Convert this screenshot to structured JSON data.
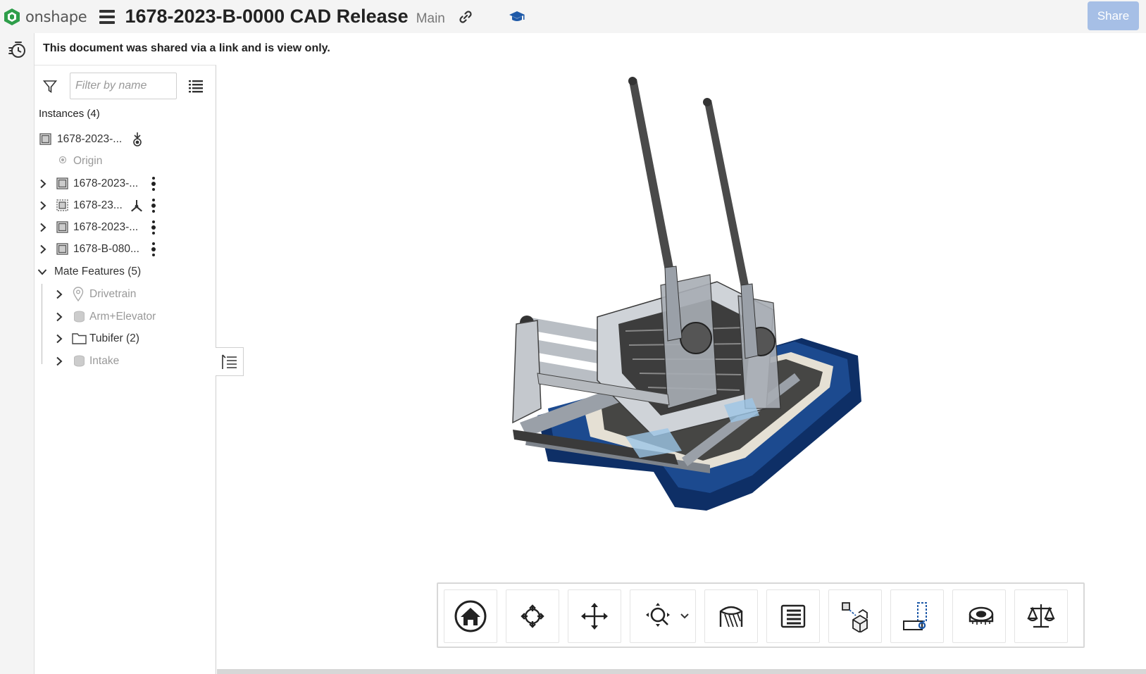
{
  "app": {
    "name": "onshape",
    "brand_color": "#2e9e4a",
    "accent_color": "#1f5aa8"
  },
  "header": {
    "title": "1678-2023-B-0000 CAD Release",
    "branch": "Main",
    "share_label": "Share",
    "share_color": "#a6bfe6"
  },
  "notice": "This document was shared via a link and is view only.",
  "panel": {
    "filter_placeholder": "Filter by name",
    "instances_header": "Instances (4)",
    "items": [
      {
        "label": "1678-2023-...",
        "icon": "part-studio-icon",
        "trailing": "fixed-icon"
      },
      {
        "label": "Origin",
        "icon": "origin-icon",
        "muted": true
      },
      {
        "label": "1678-2023-...",
        "icon": "part-studio-icon",
        "trailing": "kebab"
      },
      {
        "label": "1678-23...",
        "icon": "assembly-icon",
        "trailing": "mate-connector-icon"
      },
      {
        "label": "1678-2023-...",
        "icon": "part-studio-icon",
        "trailing": "kebab"
      },
      {
        "label": "1678-B-080...",
        "icon": "part-studio-icon",
        "trailing": "kebab"
      }
    ],
    "mate_header": "Mate Features (5)",
    "mates": [
      {
        "label": "Drivetrain",
        "icon": "pin-icon",
        "muted": true
      },
      {
        "label": "Arm+Elevator",
        "icon": "group-icon",
        "muted": true
      },
      {
        "label": "Tubifer (2)",
        "icon": "folder-icon",
        "muted": false
      },
      {
        "label": "Intake",
        "icon": "group-icon",
        "muted": true
      }
    ]
  },
  "toolbar": {
    "tools": [
      "home-view-icon",
      "rotate-icon",
      "pan-icon",
      "zoom-icon",
      "section-view-icon",
      "list-view-icon",
      "explode-icon",
      "mate-connector-icon",
      "measure-icon",
      "mass-properties-icon"
    ]
  },
  "model": {
    "frame_color": "#0e2f66",
    "metal_color": "#8a8f96"
  }
}
